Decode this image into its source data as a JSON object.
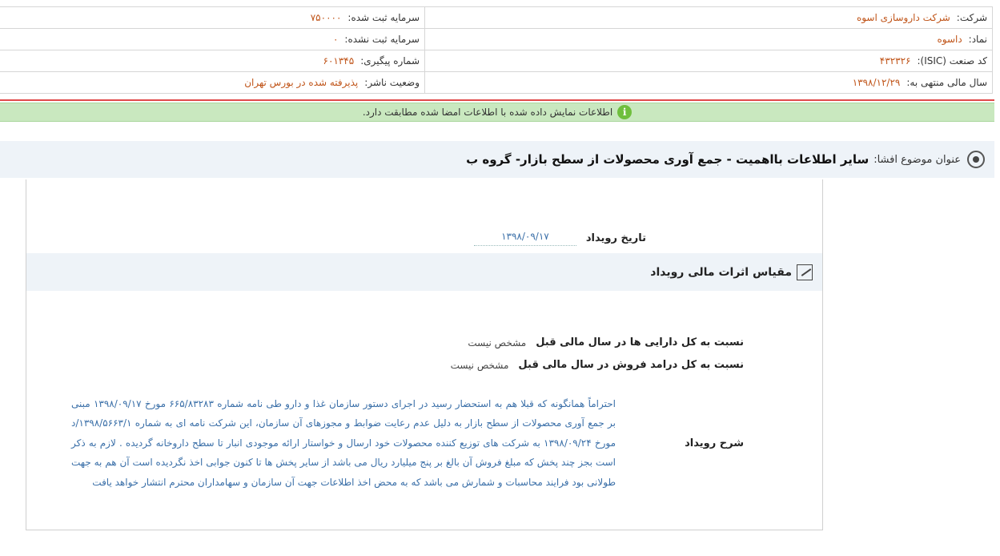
{
  "header": {
    "company_label": "شرکت:",
    "company_value": "شرکت داروسازی اسوه",
    "registered_capital_label": "سرمایه ثبت شده:",
    "registered_capital_value": "۷۵۰۰۰۰",
    "symbol_label": "نماد:",
    "symbol_value": "داسوه",
    "unregistered_capital_label": "سرمایه ثبت نشده:",
    "unregistered_capital_value": "۰",
    "isic_label": "کد صنعت (ISIC):",
    "isic_value": "۴۳۲۳۲۶",
    "tracking_label": "شماره پیگیری:",
    "tracking_value": "۶۰۱۳۴۵",
    "fiscal_year_label": "سال مالی منتهی به:",
    "fiscal_year_value": "۱۳۹۸/۱۲/۲۹",
    "publisher_status_label": "وضعیت ناشر:",
    "publisher_status_value": "پذیرفته شده در بورس تهران"
  },
  "banner": {
    "icon": "info-icon",
    "text": "اطلاعات نمایش داده شده با اطلاعات امضا شده مطابقت دارد."
  },
  "title": {
    "label": "عنوان موضوع افشا:",
    "value": "سایر اطلاعات بااهمیت - جمع آوری محصولات از سطح بازار- گروه ب"
  },
  "event": {
    "date_label": "تاریخ رویداد",
    "date_value": "۱۳۹۸/۰۹/۱۷"
  },
  "section": {
    "title": "مقیاس اثرات مالی رویداد",
    "ratio_assets_label": "نسبت به کل دارایی ها در سال مالی قبل",
    "ratio_assets_value": "مشخص نیست",
    "ratio_sales_label": "نسبت به کل درامد فروش در سال مالی قبل",
    "ratio_sales_value": "مشخص نیست"
  },
  "description": {
    "label": "شرح رویداد",
    "text": "احتراماً همانگونه که قبلا هم به استحضار رسید در اجرای دستور سازمان غذا و دارو طی نامه شماره ۶۶۵/۸۳۲۸۳ مورخ ۱۳۹۸/۰۹/۱۷ مبنی بر جمع آوری محصولات از سطح بازار به دلیل عدم رعایت ضوابط و مجوزهای آن سازمان، این شرکت نامه ای به شماره ۱۳۹۸/۵۶۶۳/۱/د مورخ ۱۳۹۸/۰۹/۲۴ به شرکت های توزیع کننده محصولات خود ارسال و خواستار ارائه موجودی انبار تا سطح داروخانه گردیده . لازم به ذکر است بجز چند پخش که مبلغ فروش آن بالغ بر پنج میلیارد ریال می باشد از سایر پخش ها تا کنون جوابی اخذ نگردیده است آن هم به جهت طولانی بود فرایند محاسبات و شمارش می باشد که به محض اخذ اطلاعات جهت آن سازمان و سهامداران محترم انتشار خواهد یافت"
  }
}
